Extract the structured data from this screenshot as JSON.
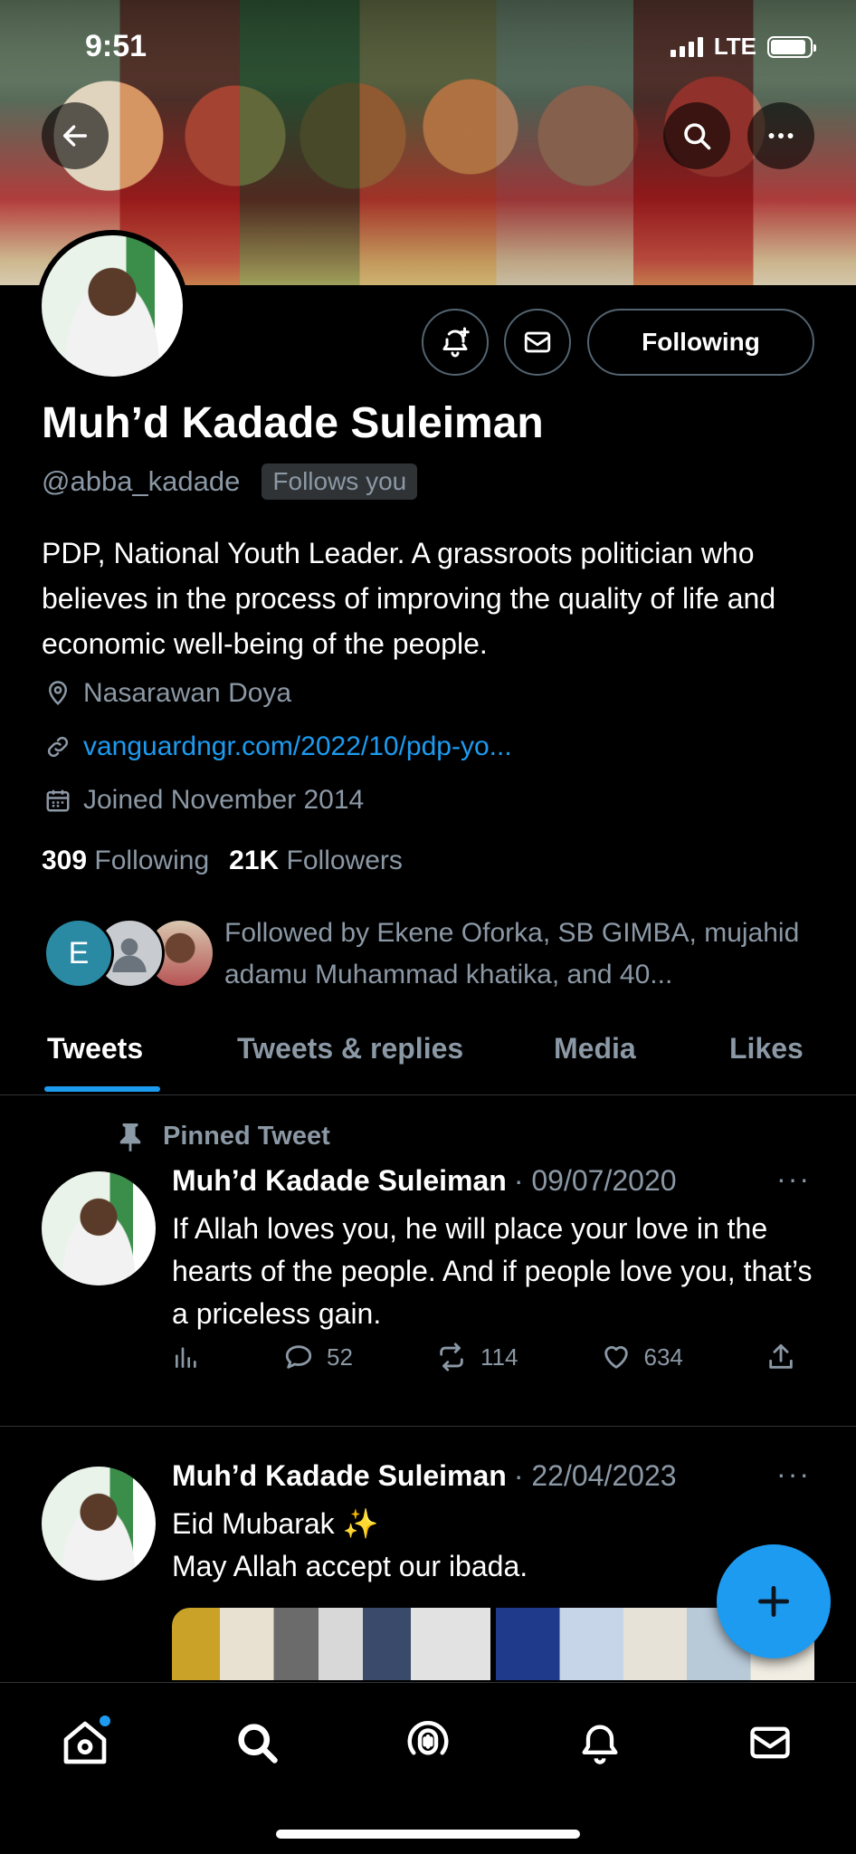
{
  "status_bar": {
    "time": "9:51",
    "network": "LTE",
    "battery_level": 0.9
  },
  "profile": {
    "display_name": "Muh’d Kadade Suleiman",
    "handle": "@abba_kadade",
    "follows_you_badge": "Follows you",
    "following_button": "Following",
    "bio": "PDP, National Youth Leader. A grassroots politician who believes in the process of improving the quality of life and economic well-being of the people.",
    "location": "Nasarawan Doya",
    "link": "vanguardngr.com/2022/10/pdp-yo...",
    "joined": "Joined November 2014",
    "following_count": "309",
    "following_label": "Following",
    "followers_count": "21K",
    "followers_label": "Followers",
    "followed_by_avatar_initial": "E",
    "followed_by_text": "Followed by Ekene Oforka, SB GIMBA, mujahid adamu Muhammad khatika, and 40..."
  },
  "tabs": [
    {
      "label": "Tweets",
      "active": true
    },
    {
      "label": "Tweets & replies",
      "active": false
    },
    {
      "label": "Media",
      "active": false
    },
    {
      "label": "Likes",
      "active": false
    }
  ],
  "tweets": [
    {
      "pinned_label": "Pinned Tweet",
      "author": "Muh’d Kadade Suleiman",
      "date": "· 09/07/2020",
      "more": "···",
      "text": "If Allah loves you, he will place your love in the hearts of the people. And if people love you, that’s a priceless gain.",
      "replies": "52",
      "retweets": "114",
      "likes": "634"
    },
    {
      "author": "Muh’d Kadade Suleiman",
      "date": "· 22/04/2023",
      "more": "···",
      "text": "Eid Mubarak ✨\nMay Allah accept our ibada."
    }
  ],
  "colors": {
    "accent": "#1d9bf0",
    "background": "#000000",
    "secondary_text": "#8b98a5",
    "border": "#2f3336"
  },
  "icons": {
    "back": "arrow-left-icon",
    "search": "search-icon",
    "more": "more-horizontal-icon",
    "notifications_add": "bell-plus-icon",
    "message": "envelope-icon",
    "location": "location-pin-icon",
    "link": "link-icon",
    "calendar": "calendar-icon",
    "pin": "pin-icon",
    "views": "analytics-icon",
    "reply": "reply-icon",
    "retweet": "retweet-icon",
    "like": "heart-icon",
    "share": "share-icon",
    "compose": "plus-icon",
    "home": "home-icon",
    "spaces": "spaces-icon",
    "notifications": "bell-icon",
    "messages": "envelope-icon"
  }
}
